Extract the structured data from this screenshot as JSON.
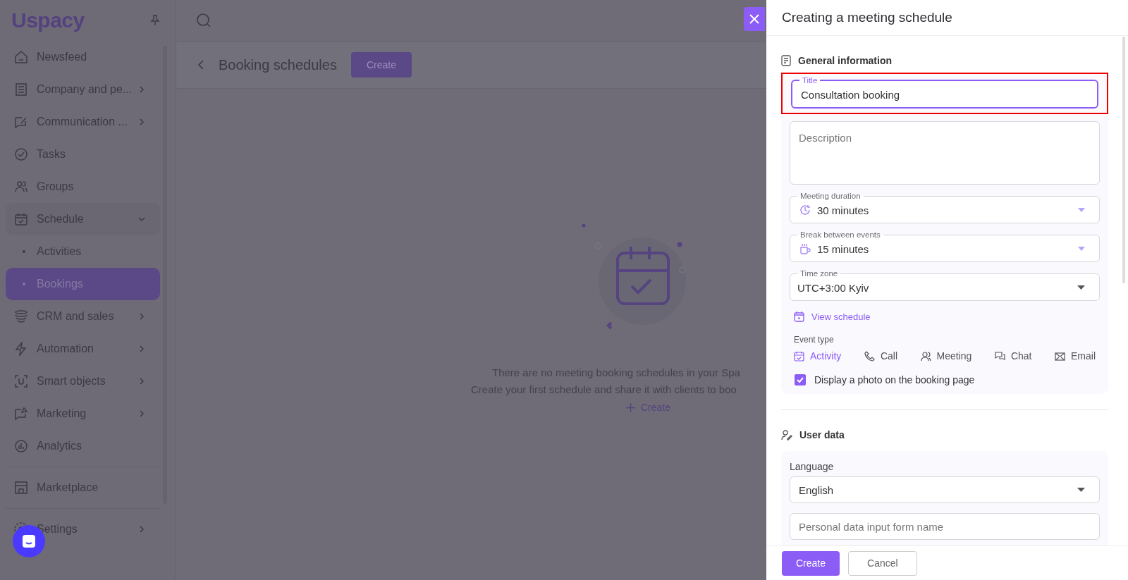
{
  "sidebar": {
    "logo": "Uspacy",
    "items": [
      {
        "label": "Newsfeed",
        "expandable": false,
        "expanded": false,
        "selected": false
      },
      {
        "label": "Company and pe...",
        "expandable": true,
        "expanded": false,
        "selected": false
      },
      {
        "label": "Communication ...",
        "expandable": true,
        "expanded": false,
        "selected": false
      },
      {
        "label": "Tasks",
        "expandable": false,
        "expanded": false,
        "selected": false
      },
      {
        "label": "Groups",
        "expandable": false,
        "expanded": false,
        "selected": false
      },
      {
        "label": "Schedule",
        "expandable": true,
        "expanded": true,
        "selected": false,
        "children": [
          {
            "label": "Activities",
            "selected": false
          },
          {
            "label": "Bookings",
            "selected": true
          }
        ]
      },
      {
        "label": "CRM and sales",
        "expandable": true,
        "expanded": false,
        "selected": false
      },
      {
        "label": "Automation",
        "expandable": true,
        "expanded": false,
        "selected": false
      },
      {
        "label": "Smart objects",
        "expandable": true,
        "expanded": false,
        "selected": false
      },
      {
        "label": "Marketing",
        "expandable": true,
        "expanded": false,
        "selected": false
      },
      {
        "label": "Analytics",
        "expandable": false,
        "expanded": false,
        "selected": false
      }
    ],
    "bottom_items": [
      {
        "label": "Marketplace",
        "expandable": false
      },
      {
        "label": "Settings",
        "expandable": true
      }
    ]
  },
  "main": {
    "page_title": "Booking schedules",
    "create_button": "Create",
    "empty_state": {
      "lines": [
        "There are no meeting booking schedules in your Spa",
        "Create your first schedule and share it with clients to boo"
      ],
      "create_link": "Create"
    }
  },
  "panel": {
    "title": "Creating a meeting schedule",
    "general": {
      "heading": "General information",
      "title_field": {
        "label": "Title",
        "value": "Consultation booking",
        "focused": true,
        "highlighted": true
      },
      "description": {
        "placeholder": "Description"
      },
      "duration": {
        "label": "Meeting duration",
        "value": "30 minutes"
      },
      "break": {
        "label": "Break between events",
        "value": "15 minutes"
      },
      "time_zone": {
        "label": "Time zone",
        "value": "UTC+3:00 Kyiv"
      },
      "view_schedule": "View schedule",
      "event_type": {
        "label": "Event type",
        "options": [
          {
            "label": "Activity",
            "selected": true
          },
          {
            "label": "Call",
            "selected": false
          },
          {
            "label": "Meeting",
            "selected": false
          },
          {
            "label": "Chat",
            "selected": false
          },
          {
            "label": "Email",
            "selected": false
          }
        ]
      },
      "photo_checkbox": {
        "label": "Display a photo on the booking page",
        "checked": true
      }
    },
    "user_data": {
      "heading": "User data",
      "language_label": "Language",
      "language": "English",
      "form_name": {
        "placeholder": "Personal data input form name"
      }
    },
    "buttons": [
      {
        "label": "Create",
        "kind": "primary"
      },
      {
        "label": "Cancel",
        "kind": "secondary"
      }
    ]
  }
}
